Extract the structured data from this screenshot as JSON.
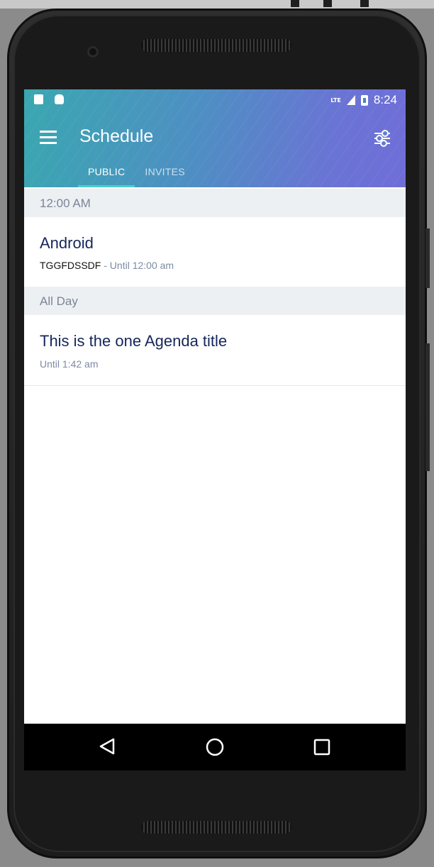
{
  "statusbar": {
    "network": "LTE",
    "time": "8:24"
  },
  "toolbar": {
    "title": "Schedule"
  },
  "tabs": [
    {
      "label": "PUBLIC"
    },
    {
      "label": "INVITES"
    }
  ],
  "sections": [
    {
      "header": "12:00 AM",
      "items": [
        {
          "title": "Android",
          "location": "TGGFDSSDF",
          "separator": " - ",
          "time": "Until 12:00 am"
        }
      ]
    },
    {
      "header": "All Day",
      "items": [
        {
          "title": "This is the one Agenda title",
          "time": "Until 1:42 am"
        }
      ]
    }
  ],
  "icons": {
    "menu": "hamburger-icon",
    "filter": "filter-sliders-icon",
    "back": "back-triangle-icon",
    "home": "home-circle-icon",
    "recent": "recents-square-icon"
  },
  "colors": {
    "accent": "#49d0c9",
    "title_text": "#15265b",
    "section_bg": "#edf0f3"
  }
}
